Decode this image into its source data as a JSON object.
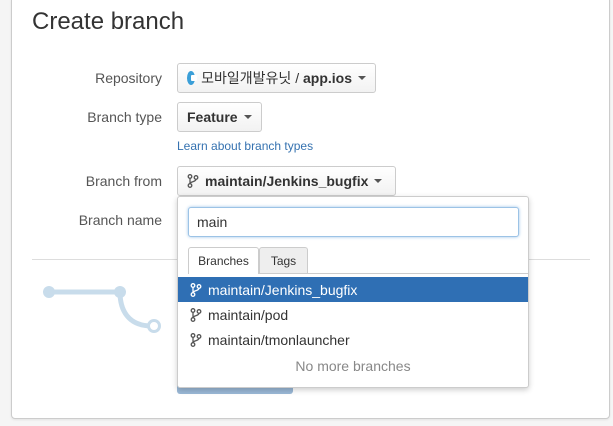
{
  "page": {
    "title": "Create branch"
  },
  "form": {
    "repository_label": "Repository",
    "repository_project": "모바일개발유닛",
    "repository_separator": " / ",
    "repository_name": "app.ios",
    "branch_type_label": "Branch type",
    "branch_type_value": "Feature",
    "learn_link": "Learn about branch types",
    "branch_from_label": "Branch from",
    "branch_from_value": "maintain/Jenkins_bugfix",
    "branch_name_label": "Branch name"
  },
  "dropdown": {
    "search_value": "main",
    "tabs": [
      {
        "label": "Branches",
        "active": true
      },
      {
        "label": "Tags",
        "active": false
      }
    ],
    "items": [
      {
        "label": "maintain/Jenkins_bugfix",
        "selected": true
      },
      {
        "label": "maintain/pod",
        "selected": false
      },
      {
        "label": "maintain/tmonlauncher",
        "selected": false
      }
    ],
    "footer": "No more branches"
  },
  "colors": {
    "accent": "#2f6fb4",
    "link": "#3572b0",
    "diagram": "#c8dceb"
  },
  "icons": {
    "repository": "repository-icon",
    "branch": "branch-icon",
    "caret": "caret-down-icon"
  }
}
